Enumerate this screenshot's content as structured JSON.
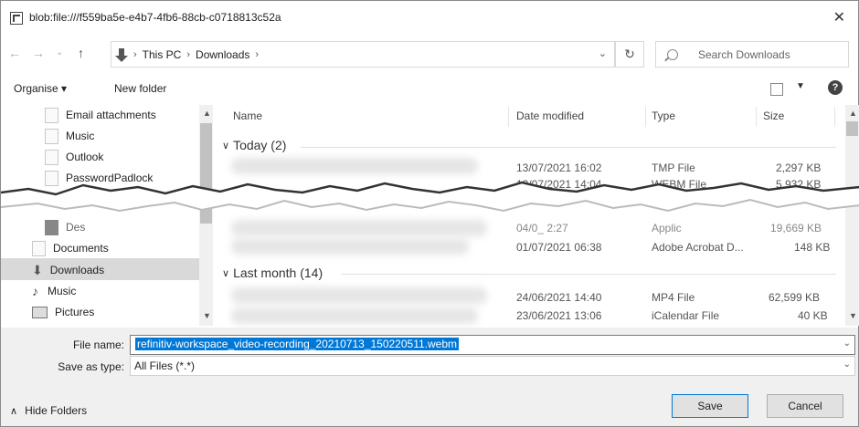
{
  "window": {
    "title": "blob:file:///f559ba5e-e4b7-4fb6-88cb-c0718813c52a",
    "close_glyph": "✕"
  },
  "address": {
    "path": [
      "This PC",
      "Downloads"
    ],
    "search_placeholder": "Search Downloads"
  },
  "toolbar": {
    "organise_label": "Organise ▾",
    "new_folder_label": "New folder",
    "help_glyph": "?"
  },
  "nav_pane": {
    "items_top": [
      "Email attachments",
      "Music",
      "Outlook",
      "PasswordPadlock"
    ],
    "partial_item": "Des",
    "items_bottom": [
      "Documents",
      "Downloads",
      "Music",
      "Pictures"
    ],
    "selected": "Downloads"
  },
  "files": {
    "columns": [
      "Name",
      "Date modified",
      "Type",
      "Size"
    ],
    "groups": [
      {
        "label": "Today (2)"
      },
      {
        "label": "Last month (14)"
      }
    ],
    "rows_today": [
      {
        "date": "13/07/2021 16:02",
        "type": "TMP File",
        "size": "2,297 KB"
      },
      {
        "date": "13/07/2021 14:04",
        "type": "WEBM File",
        "size": "5,932 KB"
      }
    ],
    "rows_partial": [
      {
        "date": "04/0_ 2:27",
        "type": "Applic",
        "size": "19,669 KB"
      },
      {
        "date": "01/07/2021 06:38",
        "type": "Adobe Acrobat D...",
        "size": "148 KB"
      }
    ],
    "rows_last_month": [
      {
        "date": "24/06/2021 14:40",
        "type": "MP4 File",
        "size": "62,599 KB"
      },
      {
        "date": "23/06/2021 13:06",
        "type": "iCalendar File",
        "size": "40 KB"
      }
    ]
  },
  "save_dialog": {
    "file_name_label": "File name:",
    "file_name_value": "refinitiv-workspace_video-recording_20210713_150220511.webm",
    "save_as_type_label": "Save as type:",
    "save_as_type_value": "All Files (*.*)",
    "hide_folders_label": "Hide Folders",
    "save_label": "Save",
    "cancel_label": "Cancel"
  }
}
